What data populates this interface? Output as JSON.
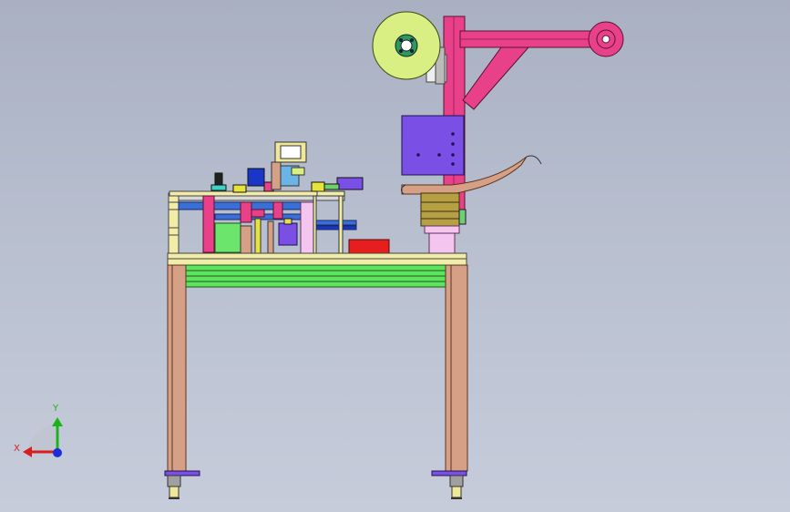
{
  "viewport": {
    "background_top": "#a9b0c2",
    "background_bottom": "#c6ccda"
  },
  "triad": {
    "x_label": "X",
    "y_label": "Y",
    "x_color": "#d81e1e",
    "y_color": "#1bb31b",
    "z_color": "#1e2bd8"
  },
  "colors": {
    "frame_leg": "#d5a085",
    "frame_top": "#f1eda8",
    "rail_green": "#5de35d",
    "column_pink": "#e8418a",
    "roll_yellow_green": "#d9ef84",
    "block_purple": "#7a4fe6",
    "block_red": "#e61e1e",
    "block_pink_light": "#f4c6ef",
    "block_olive": "#b7a044",
    "tube_tan": "#d5a085"
  }
}
